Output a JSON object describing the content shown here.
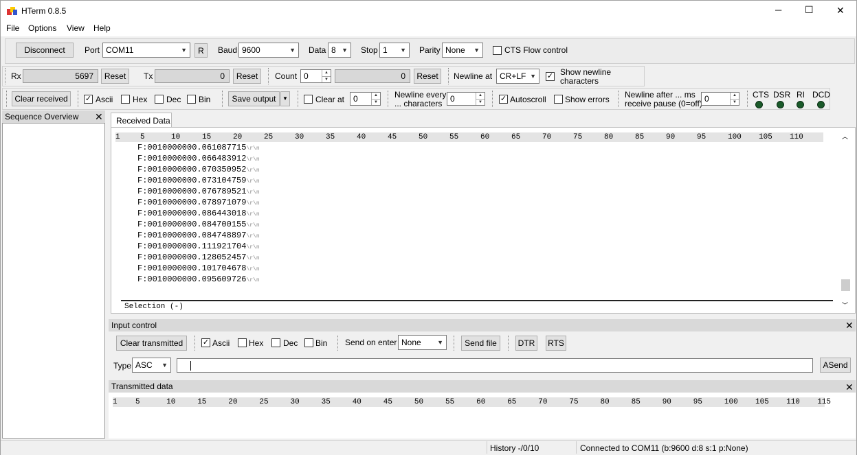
{
  "window": {
    "title": "HTerm 0.8.5",
    "minimize": "─",
    "maximize": "☐",
    "close": "✕"
  },
  "menu": [
    "File",
    "Options",
    "View",
    "Help"
  ],
  "connection": {
    "disconnect": "Disconnect",
    "port_label": "Port",
    "port_value": "COM11",
    "refresh": "R",
    "baud_label": "Baud",
    "baud_value": "9600",
    "data_label": "Data",
    "data_value": "8",
    "stop_label": "Stop",
    "stop_value": "1",
    "parity_label": "Parity",
    "parity_value": "None",
    "cts_label": "CTS Flow control"
  },
  "counters": {
    "rx_label": "Rx",
    "rx_value": "5697",
    "rx_reset": "Reset",
    "tx_label": "Tx",
    "tx_value": "0",
    "tx_reset": "Reset",
    "count_label": "Count",
    "count_value": "0",
    "count_field": "0",
    "count_reset": "Reset",
    "newline_label": "Newline at",
    "newline_value": "CR+LF",
    "show_newline_1": "Show newline",
    "show_newline_2": "characters"
  },
  "receive_toolbar": {
    "clear_received": "Clear received",
    "ascii": "Ascii",
    "hex": "Hex",
    "dec": "Dec",
    "bin": "Bin",
    "save_output": "Save output",
    "clear_at": "Clear at",
    "clear_at_value": "0",
    "newline_every_1": "Newline every",
    "newline_every_2": "... characters",
    "newline_every_value": "0",
    "autoscroll": "Autoscroll",
    "show_errors": "Show errors",
    "newline_after_1": "Newline after ... ms",
    "newline_after_2": "receive pause (0=off)",
    "newline_after_value": "0",
    "cts": "CTS",
    "dsr": "DSR",
    "ri": "RI",
    "dcd": "DCD"
  },
  "sequence_overview": {
    "title": "Sequence Overview"
  },
  "received": {
    "tab": "Received Data",
    "ruler": [
      "1",
      "5",
      "10",
      "15",
      "20",
      "25",
      "30",
      "35",
      "40",
      "45",
      "50",
      "55",
      "60",
      "65",
      "70",
      "75",
      "80",
      "85",
      "90",
      "95",
      "100",
      "105",
      "110"
    ],
    "lines": [
      "F:0010000000.061087715",
      "F:0010000000.066483912",
      "F:0010000000.070350952",
      "F:0010000000.073104759",
      "F:0010000000.076789521",
      "F:0010000000.078971079",
      "F:0010000000.086443018",
      "F:0010000000.084700155",
      "F:0010000000.084748897",
      "F:0010000000.111921704",
      "F:0010000000.128052457",
      "F:0010000000.101704678",
      "F:0010000000.095609726"
    ],
    "line_end": "\\r\\n",
    "selection": "Selection (-)"
  },
  "input_control": {
    "title": "Input control",
    "clear_transmitted": "Clear transmitted",
    "ascii": "Ascii",
    "hex": "Hex",
    "dec": "Dec",
    "bin": "Bin",
    "send_on_enter": "Send on enter",
    "send_on_enter_value": "None",
    "send_file": "Send file",
    "dtr": "DTR",
    "rts": "RTS",
    "type_label": "Type",
    "type_value": "ASC",
    "asend": "ASend"
  },
  "transmitted": {
    "title": "Transmitted data",
    "ruler": [
      "1",
      "5",
      "10",
      "15",
      "20",
      "25",
      "30",
      "35",
      "40",
      "45",
      "50",
      "55",
      "60",
      "65",
      "70",
      "75",
      "80",
      "85",
      "90",
      "95",
      "100",
      "105",
      "110",
      "115"
    ]
  },
  "status": {
    "history": "History -/0/10",
    "connected": "Connected to COM11 (b:9600 d:8 s:1 p:None)"
  }
}
